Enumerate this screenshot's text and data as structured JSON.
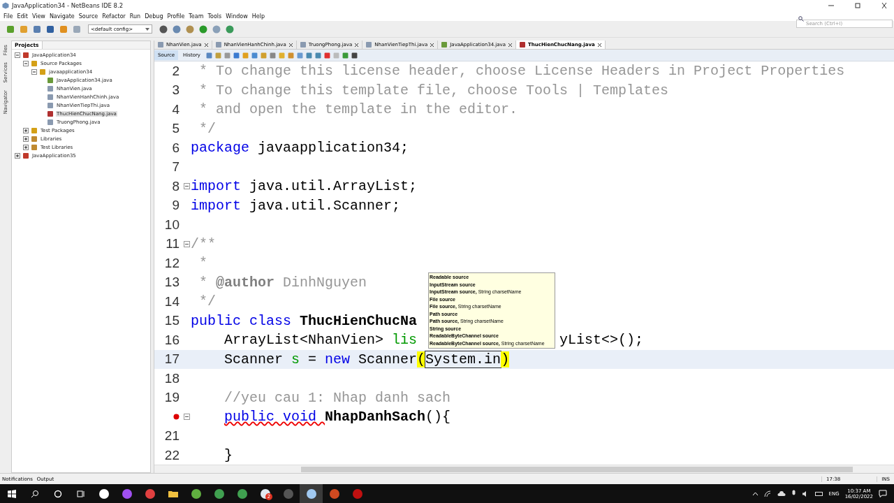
{
  "window": {
    "title": "JavaApplication34 - NetBeans IDE 8.2"
  },
  "menu": [
    "File",
    "Edit",
    "View",
    "Navigate",
    "Source",
    "Refactor",
    "Run",
    "Debug",
    "Profile",
    "Team",
    "Tools",
    "Window",
    "Help"
  ],
  "config": {
    "value": "<default config>"
  },
  "search": {
    "placeholder": "Search (Ctrl+I)"
  },
  "side_tabs": [
    "Files",
    "Services",
    "Navigator"
  ],
  "projects": {
    "title": "Projects",
    "tree": [
      {
        "label": "JavaApplication34",
        "kind": "project",
        "expanded": true,
        "selected": false,
        "children": [
          {
            "label": "Source Packages",
            "kind": "folder",
            "expanded": true,
            "selected": false,
            "children": [
              {
                "label": "javaapplication34",
                "kind": "package",
                "expanded": true,
                "selected": false,
                "children": [
                  {
                    "label": "JavaApplication34.java",
                    "kind": "main",
                    "selected": false
                  },
                  {
                    "label": "NhanVien.java",
                    "kind": "file",
                    "selected": false
                  },
                  {
                    "label": "NhanVienHanhChinh.java",
                    "kind": "file",
                    "selected": false
                  },
                  {
                    "label": "NhanVienTiepThi.java",
                    "kind": "file",
                    "selected": false
                  },
                  {
                    "label": "ThucHienChucNang.java",
                    "kind": "error",
                    "selected": true
                  },
                  {
                    "label": "TruongPhong.java",
                    "kind": "file",
                    "selected": false
                  }
                ]
              }
            ]
          },
          {
            "label": "Test Packages",
            "kind": "folder",
            "expanded": false,
            "selected": false
          },
          {
            "label": "Libraries",
            "kind": "library",
            "expanded": false,
            "selected": false
          },
          {
            "label": "Test Libraries",
            "kind": "library",
            "expanded": false,
            "selected": false
          }
        ]
      },
      {
        "label": "JavaApplication35",
        "kind": "project",
        "expanded": false,
        "selected": false
      }
    ]
  },
  "editor_tabs": [
    {
      "label": "NhanVien.java",
      "kind": "file",
      "selected": false
    },
    {
      "label": "NhanVienHanhChinh.java",
      "kind": "file",
      "selected": false
    },
    {
      "label": "TruongPhong.java",
      "kind": "file",
      "selected": false
    },
    {
      "label": "NhanVienTiepThi.java",
      "kind": "file",
      "selected": false
    },
    {
      "label": "JavaApplication34.java",
      "kind": "main",
      "selected": false
    },
    {
      "label": "ThucHienChucNang.java",
      "kind": "error",
      "selected": true
    }
  ],
  "view_tabs": [
    {
      "label": "Source",
      "selected": true
    },
    {
      "label": "History",
      "selected": false
    }
  ],
  "code": [
    {
      "number": "2",
      "fold": false,
      "current": false,
      "error": false,
      "indented": false,
      "tokens": [
        {
          "kind": "comment",
          "text": " * To change this license header, choose License Headers in Project Properties"
        }
      ]
    },
    {
      "number": "3",
      "fold": false,
      "current": false,
      "error": false,
      "indented": false,
      "tokens": [
        {
          "kind": "comment",
          "text": " * To change this template file, choose Tools | Templates"
        }
      ]
    },
    {
      "number": "4",
      "fold": false,
      "current": false,
      "error": false,
      "indented": false,
      "tokens": [
        {
          "kind": "comment",
          "text": " * and open the template in the editor."
        }
      ]
    },
    {
      "number": "5",
      "fold": false,
      "current": false,
      "error": false,
      "indented": false,
      "tokens": [
        {
          "kind": "comment",
          "text": " */"
        }
      ]
    },
    {
      "number": "6",
      "fold": false,
      "current": false,
      "error": false,
      "indented": false,
      "tokens": [
        {
          "kind": "keyword",
          "text": "package"
        },
        {
          "kind": "text",
          "text": " javaapplication34;"
        }
      ]
    },
    {
      "number": "7",
      "fold": false,
      "current": false,
      "error": false
    },
    {
      "number": "8",
      "fold": true,
      "current": false,
      "error": false,
      "indented": false,
      "tokens": [
        {
          "kind": "keyword",
          "text": "import"
        },
        {
          "kind": "text",
          "text": " java.util.ArrayList;"
        }
      ]
    },
    {
      "number": "9",
      "fold": false,
      "current": false,
      "error": false,
      "indented": false,
      "tokens": [
        {
          "kind": "keyword",
          "text": "import"
        },
        {
          "kind": "text",
          "text": " java.util.Scanner;"
        }
      ]
    },
    {
      "number": "10",
      "fold": false,
      "current": false,
      "error": false
    },
    {
      "number": "11",
      "fold": true,
      "current": false,
      "error": false,
      "indented": false,
      "tokens": [
        {
          "kind": "comment",
          "text": "/**"
        }
      ]
    },
    {
      "number": "12",
      "fold": false,
      "current": false,
      "error": false,
      "indented": false,
      "tokens": [
        {
          "kind": "comment",
          "text": " *"
        }
      ]
    },
    {
      "number": "13",
      "fold": false,
      "current": false,
      "error": false,
      "indented": false,
      "tokens": [
        {
          "kind": "comment",
          "text": " * "
        },
        {
          "kind": "tag",
          "text": "@author"
        },
        {
          "kind": "comment",
          "text": " DinhNguyen"
        }
      ]
    },
    {
      "number": "14",
      "fold": false,
      "current": false,
      "error": false,
      "indented": false,
      "tokens": [
        {
          "kind": "comment",
          "text": " */"
        }
      ]
    },
    {
      "number": "15",
      "fold": false,
      "current": false,
      "error": false,
      "indented": false,
      "tokens": [
        {
          "kind": "keyword",
          "text": "public class "
        },
        {
          "kind": "name",
          "text": "ThucHienChucNa"
        }
      ]
    },
    {
      "number": "16",
      "fold": false,
      "current": false,
      "error": false,
      "indented": true,
      "tokens": [
        {
          "kind": "text",
          "text": "ArrayList<NhanVien> "
        },
        {
          "kind": "field",
          "text": "lis"
        },
        {
          "kind": "tail",
          "text": "yList<>();"
        }
      ]
    },
    {
      "number": "17",
      "fold": false,
      "current": true,
      "error": false,
      "indented": true,
      "tokens": [
        {
          "kind": "text",
          "text": "Scanner "
        },
        {
          "kind": "field",
          "text": "s"
        },
        {
          "kind": "text",
          "text": " = "
        },
        {
          "kind": "keyword",
          "text": "new"
        },
        {
          "kind": "text",
          "text": " Scanner"
        },
        {
          "kind": "match",
          "text": "("
        },
        {
          "kind": "boxed",
          "text": "System.in"
        },
        {
          "kind": "match",
          "text": ")"
        }
      ]
    },
    {
      "number": "18",
      "fold": false,
      "current": false,
      "error": false
    },
    {
      "number": "19",
      "fold": false,
      "current": false,
      "error": false,
      "indented": true,
      "tokens": [
        {
          "kind": "comment",
          "text": "//yeu cau 1: Nhap danh sach"
        }
      ]
    },
    {
      "fold": true,
      "current": false,
      "error": true,
      "indented": true,
      "tokens": [
        {
          "kind": "error",
          "text": "public void "
        },
        {
          "kind": "name",
          "text": "NhapDanhSach"
        },
        {
          "kind": "text",
          "text": "(){"
        }
      ]
    },
    {
      "number": "21",
      "fold": false,
      "current": false,
      "error": false
    },
    {
      "number": "22",
      "fold": false,
      "current": false,
      "error": false,
      "indented": true,
      "tokens": [
        {
          "kind": "text",
          "text": "}"
        }
      ]
    }
  ],
  "completion": [
    "**Readable source**",
    "**InputStream source**",
    "**InputStream source,** String charsetName",
    "**File source**",
    "**File source,** String charsetName",
    "**Path source**",
    "**Path source,** String charsetName",
    "**String source**",
    "**ReadableByteChannel source**",
    "**ReadableByteChannel source,** String charsetName"
  ],
  "bottom_tabs": [
    "Notifications",
    "Output"
  ],
  "status": {
    "position": "17:38",
    "mode": "INS"
  },
  "taskbar": {
    "apps": [
      {
        "kind": "notion",
        "active": false
      },
      {
        "kind": "messenger",
        "active": false
      },
      {
        "kind": "snip",
        "active": false
      },
      {
        "kind": "explorer",
        "active": false
      },
      {
        "kind": "notepad",
        "active": false
      },
      {
        "kind": "chrome",
        "active": false
      },
      {
        "kind": "chrome",
        "active": false
      },
      {
        "kind": "chat",
        "active": false,
        "badge": "2"
      },
      {
        "kind": "obs",
        "active": false
      },
      {
        "kind": "cube",
        "active": true
      },
      {
        "kind": "powerpoint",
        "active": false
      },
      {
        "kind": "acrobat",
        "active": false
      }
    ],
    "language": "ENG",
    "time": "10:37 AM",
    "date": "16/02/2022"
  }
}
